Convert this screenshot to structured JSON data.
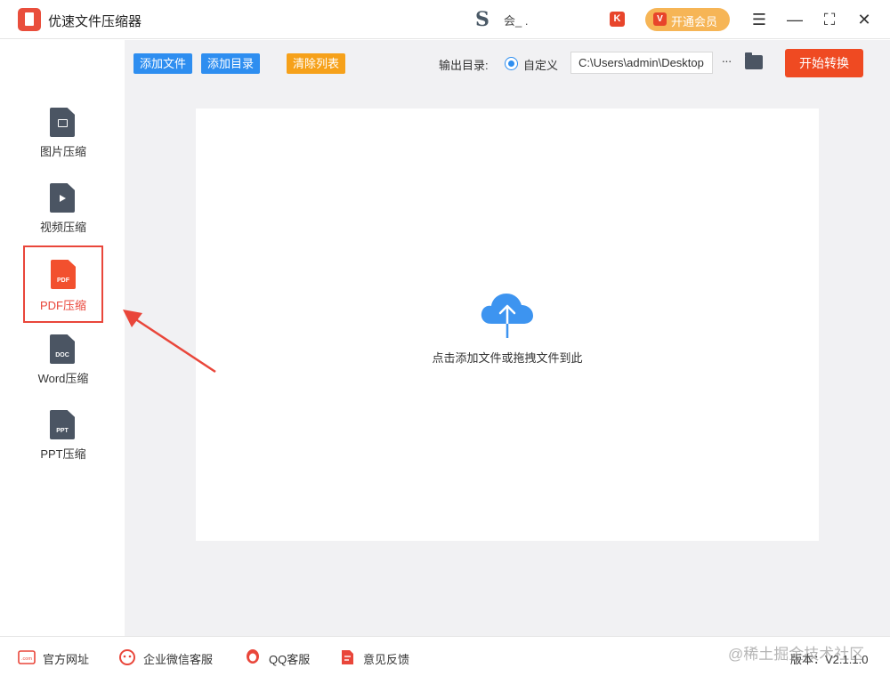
{
  "app": {
    "title": "优速文件压缩器",
    "user_name": "会_ ."
  },
  "titlebar": {
    "k_badge": "K",
    "vip_icon": "V",
    "vip_label": "开通会员",
    "menu_icon": "☰",
    "minimize_icon": "—",
    "maximize_icon": "⛶",
    "close_icon": "✕"
  },
  "sidebar": {
    "items": [
      {
        "label": "图片压缩",
        "icon": "image-file-icon"
      },
      {
        "label": "视频压缩",
        "icon": "video-file-icon"
      },
      {
        "label": "PDF压缩",
        "icon": "pdf-file-icon",
        "tag": "PDF",
        "active": true
      },
      {
        "label": "Word压缩",
        "icon": "doc-file-icon",
        "tag": "DOC"
      },
      {
        "label": "PPT压缩",
        "icon": "ppt-file-icon",
        "tag": "PPT"
      }
    ]
  },
  "toolbar": {
    "add_file": "添加文件",
    "add_folder": "添加目录",
    "clear_list": "清除列表",
    "output_label": "输出目录:",
    "custom_option": "自定义",
    "output_path": "C:\\Users\\admin\\Desktop",
    "more": "···",
    "start": "开始转换"
  },
  "drop_zone": {
    "hint": "点击添加文件或拖拽文件到此"
  },
  "footer": {
    "website": "官方网址",
    "wechat": "企业微信客服",
    "qq": "QQ客服",
    "feedback": "意见反馈",
    "version": "版本：V2.1.1.0",
    "watermark": "@稀土掘金技术社区"
  },
  "colors": {
    "accent_blue": "#2e8ef0",
    "accent_orange": "#f6a11a",
    "start_red": "#ef4a22",
    "active_red": "#e9463a",
    "vip_gold": "#f6b556"
  }
}
